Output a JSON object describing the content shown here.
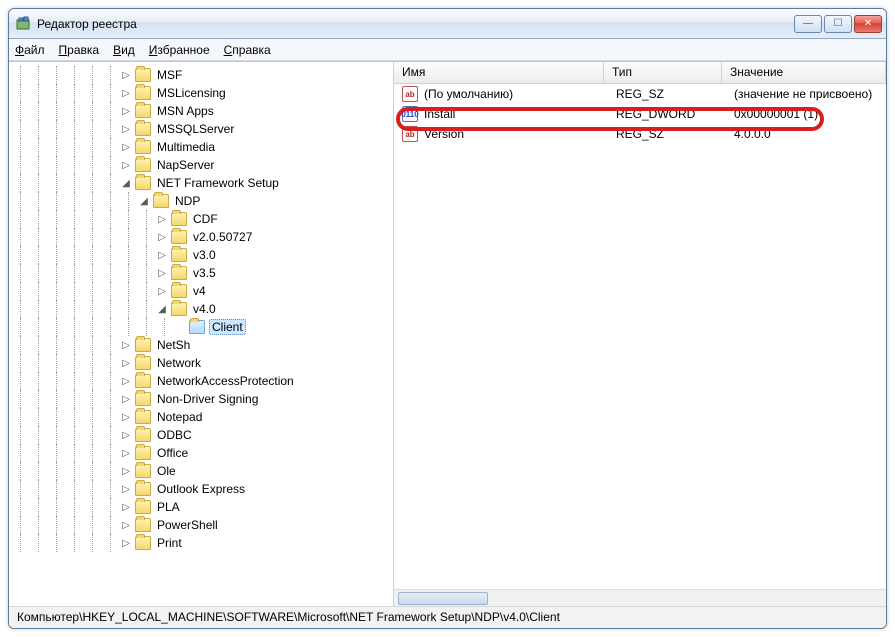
{
  "window": {
    "title": "Редактор реестра"
  },
  "menu": {
    "file": "Файл",
    "edit": "Правка",
    "view": "Вид",
    "fav": "Избранное",
    "help": "Справка"
  },
  "tree": {
    "top": [
      "MSF",
      "MSLicensing",
      "MSN Apps",
      "MSSQLServer",
      "Multimedia",
      "NapServer"
    ],
    "nfs": "NET Framework Setup",
    "ndp": "NDP",
    "ndp_children": [
      "CDF",
      "v2.0.50727",
      "v3.0",
      "v3.5",
      "v4"
    ],
    "v40": "v4.0",
    "client": "Client",
    "bottom": [
      "NetSh",
      "Network",
      "NetworkAccessProtection",
      "Non-Driver Signing",
      "Notepad",
      "ODBC",
      "Office",
      "Ole",
      "Outlook Express",
      "PLA",
      "PowerShell",
      "Print"
    ]
  },
  "list": {
    "hdr_name": "Имя",
    "hdr_type": "Тип",
    "hdr_val": "Значение",
    "rows": [
      {
        "icon": "ab",
        "name": "(По умолчанию)",
        "type": "REG_SZ",
        "val": "(значение не присвоено)"
      },
      {
        "icon": "nn",
        "name": "Install",
        "type": "REG_DWORD",
        "val": "0x00000001 (1)"
      },
      {
        "icon": "ab",
        "name": "Version",
        "type": "REG_SZ",
        "val": "4.0.0.0"
      }
    ]
  },
  "status": "Компьютер\\HKEY_LOCAL_MACHINE\\SOFTWARE\\Microsoft\\NET Framework Setup\\NDP\\v4.0\\Client"
}
